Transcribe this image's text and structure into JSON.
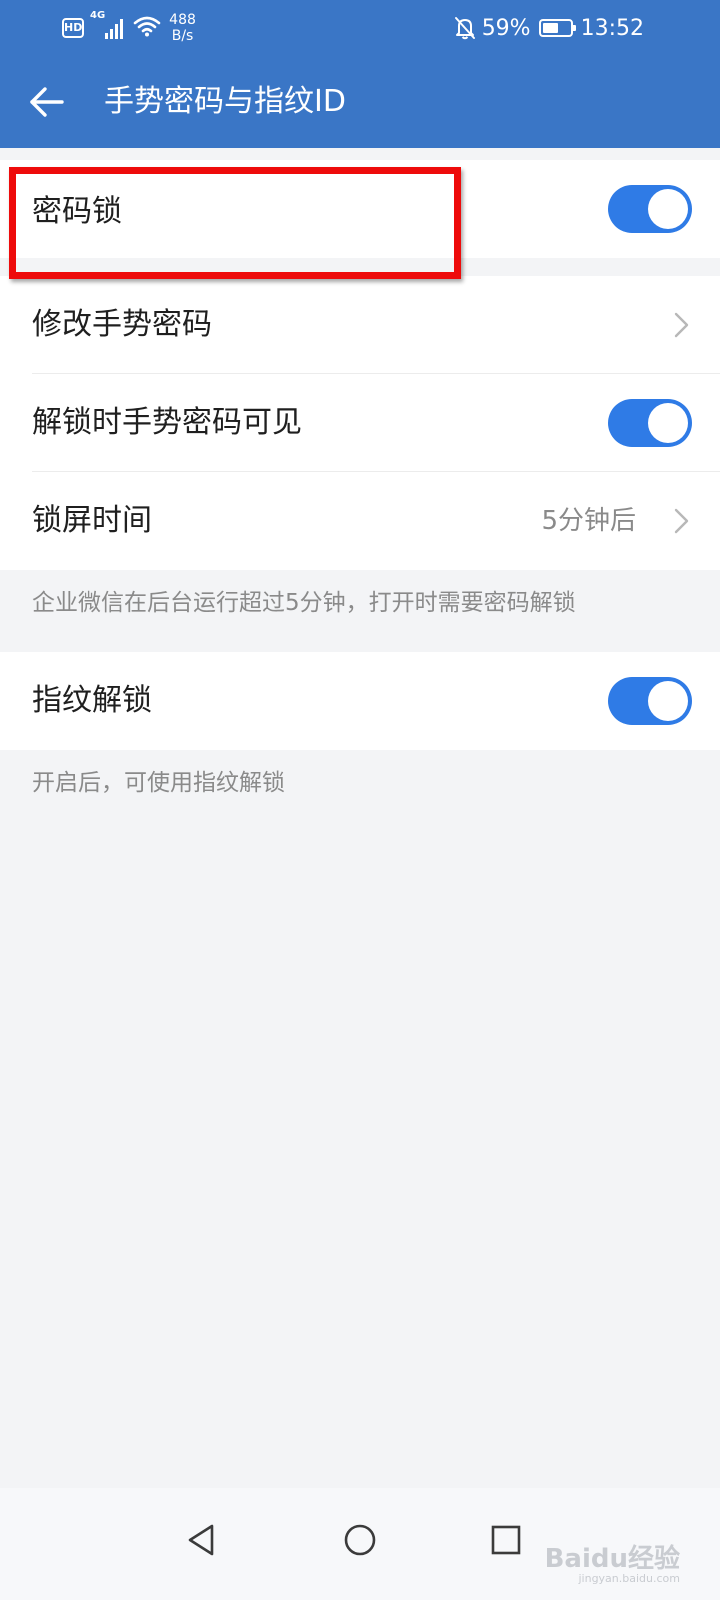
{
  "status_bar": {
    "hd": "HD",
    "network": "4G",
    "speed_value": "488",
    "speed_unit": "B/s",
    "battery_percent": "59%",
    "battery_level": 0.59,
    "time": "13:52"
  },
  "header": {
    "title": "手势密码与指纹ID",
    "back_icon": "arrow-left-icon"
  },
  "section1": {
    "password_lock": {
      "label": "密码锁",
      "enabled": true
    }
  },
  "section2": {
    "items": [
      {
        "label": "修改手势密码",
        "type": "link"
      },
      {
        "label": "解锁时手势密码可见",
        "type": "toggle",
        "enabled": true
      },
      {
        "label": "锁屏时间",
        "type": "link",
        "value": "5分钟后"
      }
    ],
    "hint": "企业微信在后台运行超过5分钟，打开时需要密码解锁"
  },
  "section3": {
    "fingerprint": {
      "label": "指纹解锁",
      "enabled": true
    },
    "hint": "开启后，可使用指纹解锁"
  },
  "watermark": {
    "main": "Baidu经验",
    "sub": "jingyan.baidu.com"
  },
  "colors": {
    "header": "#3a76c6",
    "toggle_on": "#2f7be6",
    "highlight": "#ee0b0b",
    "background": "#f3f4f6"
  }
}
